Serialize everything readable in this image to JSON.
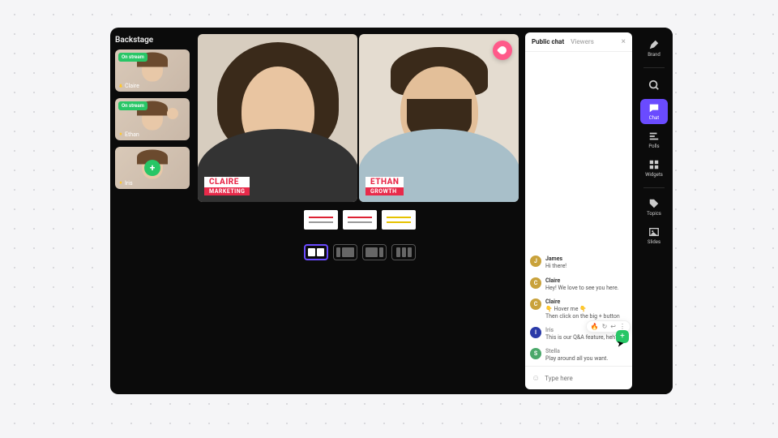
{
  "backstage": {
    "title": "Backstage",
    "tiles": [
      {
        "name": "Claire",
        "badge": "On stream"
      },
      {
        "name": "Ethan",
        "badge": "On stream"
      },
      {
        "name": "Iris",
        "badge": null,
        "plus": true
      }
    ]
  },
  "stage": {
    "speakers": [
      {
        "name": "CLAIRE",
        "role": "MARKETING"
      },
      {
        "name": "ETHAN",
        "role": "GROWTH"
      }
    ],
    "layouts": [
      "split",
      "pip-left",
      "pip-right",
      "grid"
    ],
    "selected_layout": 0
  },
  "chat": {
    "tabs": {
      "active": "Public chat",
      "inactive": "Viewers"
    },
    "messages": [
      {
        "avatar": "J",
        "color": "#c9a23b",
        "name": "James",
        "text": "Hi there!"
      },
      {
        "avatar": "C",
        "color": "#c9a23b",
        "name": "Claire",
        "text": "Hey! We love to see you here."
      },
      {
        "avatar": "C",
        "color": "#c9a23b",
        "name": "Claire",
        "text": "👇 Hover me 👇\nThen click on the big + button"
      },
      {
        "avatar": "I",
        "color": "#2a3aa8",
        "name": "Iris",
        "text": "This is our Q&A feature, heh?",
        "hovered": true,
        "dim": true
      },
      {
        "avatar": "S",
        "color": "#4aa86a",
        "name": "Stella",
        "text": "Play around all you want.",
        "dim": true
      }
    ],
    "input_placeholder": "Type here"
  },
  "rail": {
    "items": [
      {
        "id": "brand",
        "label": "Brand"
      },
      {
        "id": "chat",
        "label": "Chat",
        "selected": true
      },
      {
        "id": "polls",
        "label": "Polls"
      },
      {
        "id": "widgets",
        "label": "Widgets"
      },
      {
        "id": "topics",
        "label": "Topics"
      },
      {
        "id": "slides",
        "label": "Slides"
      }
    ]
  },
  "icons": {
    "mic": "mic-icon",
    "close": "close-icon",
    "send": "send-icon",
    "smile": "smile-icon",
    "pencil": "pencil-icon",
    "chat": "chat-bubble-icon",
    "bars": "bars-icon",
    "grid": "grid-icon",
    "tag": "tag-icon",
    "image": "image-icon",
    "search": "search-icon",
    "drop": "drop-icon",
    "cursor": "cursor-icon",
    "fire": "fire-icon",
    "refresh": "refresh-icon",
    "reply": "reply-icon",
    "dots": "dots-icon"
  }
}
